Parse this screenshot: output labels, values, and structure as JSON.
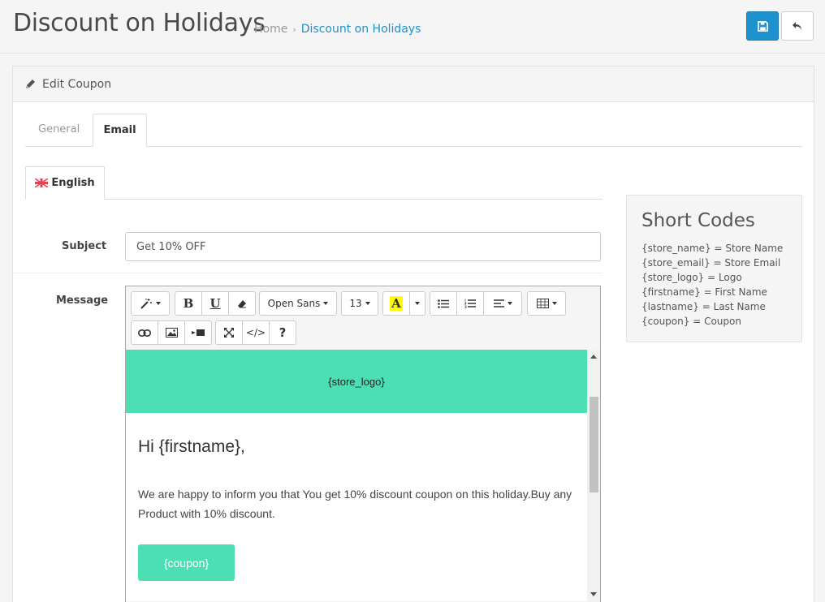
{
  "header": {
    "title": "Discount on Holidays",
    "breadcrumb": [
      {
        "label": "Home"
      },
      {
        "label": "Discount on Holidays"
      }
    ],
    "save_icon": "save-icon",
    "back_icon": "reply-icon",
    "accent": "#1e91cf"
  },
  "panel": {
    "title": "Edit Coupon",
    "icon": "pencil-icon",
    "tabs": [
      {
        "label": "General",
        "active": false
      },
      {
        "label": "Email",
        "active": true
      }
    ],
    "language_tab": "English"
  },
  "form": {
    "subject_label": "Subject",
    "subject_value": "Get 10% OFF",
    "message_label": "Message"
  },
  "editor": {
    "toolbar": {
      "font_name": "Open Sans",
      "font_size": "13",
      "highlight_glyph": "A",
      "help_glyph": "?",
      "code_glyph": "</>",
      "bold_glyph": "B",
      "underline_glyph": "U"
    },
    "content": {
      "logo_placeholder": "{store_logo}",
      "greeting": "Hi {firstname},",
      "body": "We are happy to inform you that You get 10% discount coupon on this holiday.Buy any Product with 10% discount.",
      "coupon_label": "{coupon}",
      "accent": "#4cdfb4"
    }
  },
  "shortcodes": {
    "title": "Short Codes",
    "items": [
      "{store_name} = Store Name",
      "{store_email} = Store Email",
      "{store_logo} = Logo",
      "{firstname} = First Name",
      "{lastname} = Last Name",
      "{coupon} = Coupon"
    ]
  }
}
